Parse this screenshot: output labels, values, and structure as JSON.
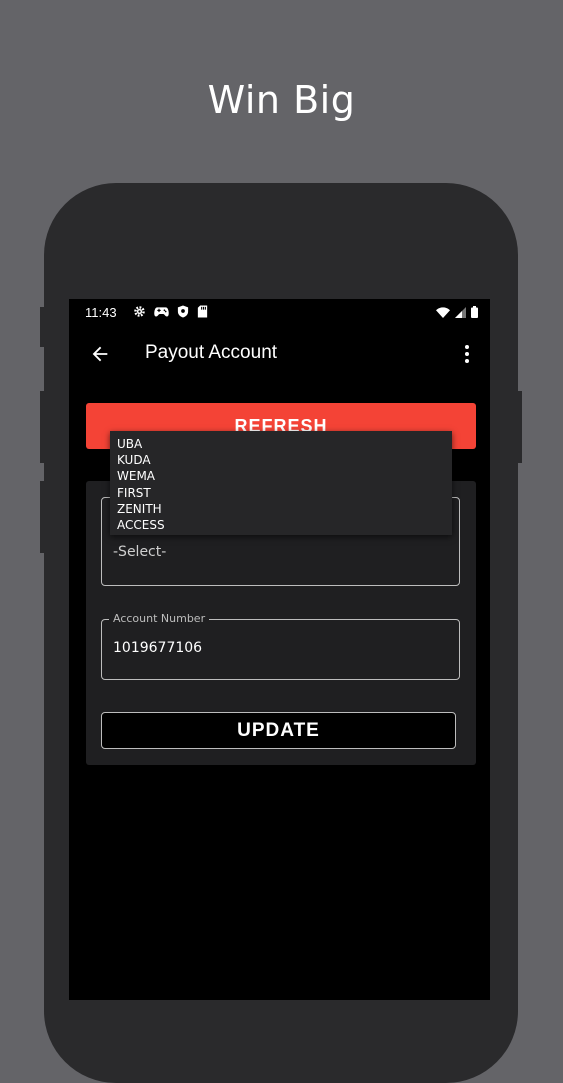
{
  "headline": "Win Big",
  "status_bar": {
    "time": "11:43",
    "left_icons": [
      "gear-icon",
      "gamepad-icon",
      "shield-icon",
      "sd-card-icon"
    ],
    "right_icons": [
      "wifi-icon",
      "signal-icon",
      "battery-icon"
    ]
  },
  "app_bar": {
    "title": "Payout Account",
    "back_icon": "arrow-back-icon",
    "menu_icon": "more-vert-icon"
  },
  "refresh_label": "REFRESH",
  "bank_select": {
    "value": "-Select-",
    "options": [
      "UBA",
      "KUDA",
      "WEMA",
      "FIRST",
      "ZENITH",
      "ACCESS"
    ]
  },
  "account_number": {
    "label": "Account Number",
    "value": "1019677106"
  },
  "update_label": "UPDATE",
  "colors": {
    "background": "#646468",
    "phone_frame": "#2a2a2c",
    "screen": "#000000",
    "accent_red": "#f44336",
    "card": "#1f1f21"
  }
}
